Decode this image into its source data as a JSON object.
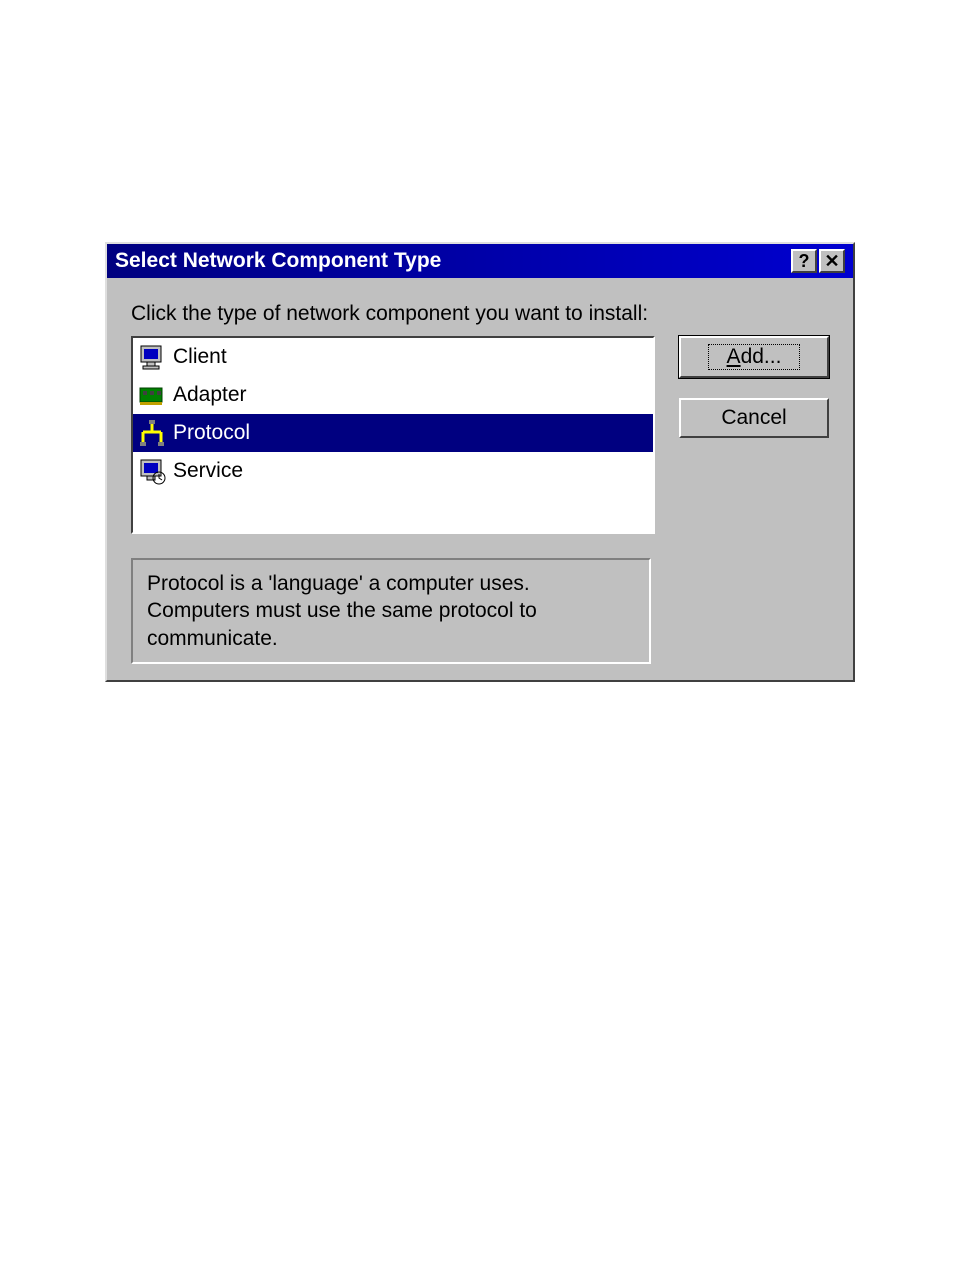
{
  "dialog": {
    "title": "Select Network Component Type",
    "instruction": "Click the type of network component you want to install:",
    "items": [
      {
        "label": "Client",
        "icon": "client-icon",
        "selected": false
      },
      {
        "label": "Adapter",
        "icon": "adapter-icon",
        "selected": false
      },
      {
        "label": "Protocol",
        "icon": "protocol-icon",
        "selected": true
      },
      {
        "label": "Service",
        "icon": "service-icon",
        "selected": false
      }
    ],
    "buttons": {
      "add": "Add...",
      "add_underline": "A",
      "cancel": "Cancel"
    },
    "description": "Protocol is a 'language' a computer uses. Computers must use the same protocol to communicate."
  }
}
